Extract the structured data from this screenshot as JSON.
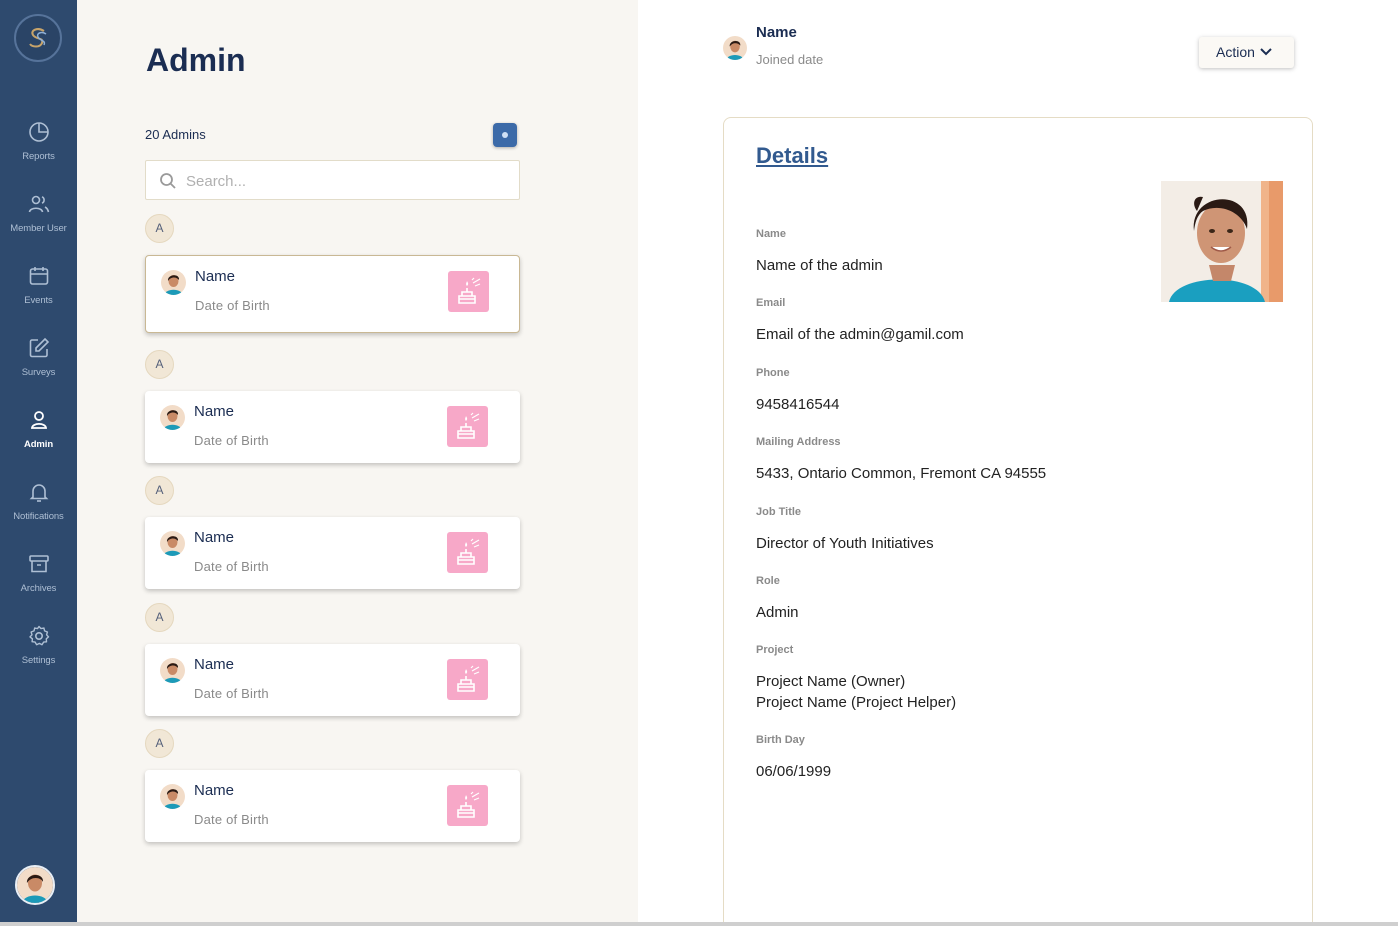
{
  "sidebar": {
    "items": [
      {
        "label": "Reports",
        "icon": "pie-chart-icon"
      },
      {
        "label": "Member User",
        "icon": "users-icon"
      },
      {
        "label": "Events",
        "icon": "calendar-icon"
      },
      {
        "label": "Surveys",
        "icon": "edit-icon"
      },
      {
        "label": "Admin",
        "icon": "user-icon",
        "active": true
      },
      {
        "label": "Notifications",
        "icon": "bell-icon"
      },
      {
        "label": "Archives",
        "icon": "archive-icon"
      },
      {
        "label": "Settings",
        "icon": "gear-icon"
      }
    ]
  },
  "list": {
    "title": "Admin",
    "count": "20 Admins",
    "search_placeholder": "Search...",
    "groups": [
      {
        "letter": "A",
        "name": "Name",
        "dob": "Date of Birth"
      },
      {
        "letter": "A",
        "name": "Name",
        "dob": "Date of Birth"
      },
      {
        "letter": "A",
        "name": "Name",
        "dob": "Date of Birth"
      },
      {
        "letter": "A",
        "name": "Name",
        "dob": "Date of Birth"
      },
      {
        "letter": "A",
        "name": "Name",
        "dob": "Date of Birth"
      }
    ]
  },
  "header": {
    "name": "Name",
    "joined": "Joined date",
    "action_label": "Action"
  },
  "details": {
    "title": "Details",
    "fields": [
      {
        "label": "Name",
        "value": "Name of the admin"
      },
      {
        "label": "Email",
        "value": "Email of the admin@gamil.com"
      },
      {
        "label": "Phone",
        "value": "9458416544"
      },
      {
        "label": "Mailing Address",
        "value": "5433, Ontario Common, Fremont CA 94555"
      },
      {
        "label": "Job Title",
        "value": "Director of Youth Initiatives"
      },
      {
        "label": "Role",
        "value": "Admin"
      },
      {
        "label": "Project",
        "value": "Project Name (Owner)",
        "value2": "Project Name (Project Helper)"
      },
      {
        "label": "Birth Day",
        "value": "06/06/1999"
      }
    ]
  },
  "colors": {
    "sidebar": "#2e4a6e",
    "accent": "#325a8f",
    "list_bg": "#f8f6f2",
    "cake_pink": "#f7a8c8"
  }
}
